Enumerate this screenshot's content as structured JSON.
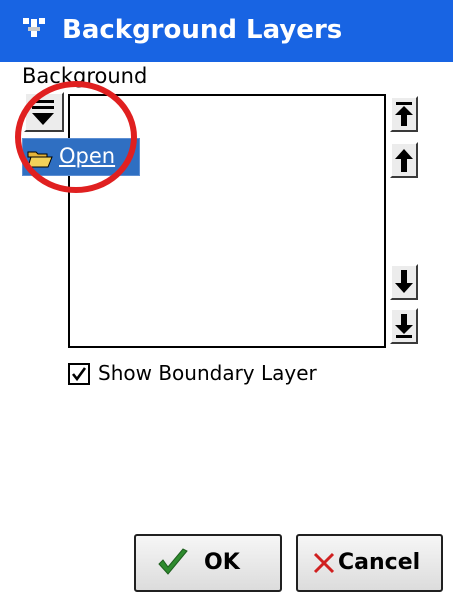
{
  "window": {
    "title": "Background Layers"
  },
  "section": {
    "label": "Background"
  },
  "popup_menu": {
    "open_label": "Open"
  },
  "options": {
    "show_boundary_label": "Show Boundary Layer",
    "show_boundary_checked": true
  },
  "footer": {
    "ok_label": "OK",
    "cancel_label": "Cancel"
  },
  "icons": {
    "app": "gps-antenna-icon",
    "menu": "menu-dropdown-icon",
    "open": "folder-open-icon",
    "move_top": "move-to-top-icon",
    "move_up": "move-up-icon",
    "move_down": "move-down-icon",
    "move_bottom": "move-to-bottom-icon",
    "ok": "checkmark-icon",
    "cancel": "x-icon"
  },
  "colors": {
    "titlebar": "#1864e3",
    "selection": "#2f6fc2",
    "annotation": "#e02020"
  }
}
